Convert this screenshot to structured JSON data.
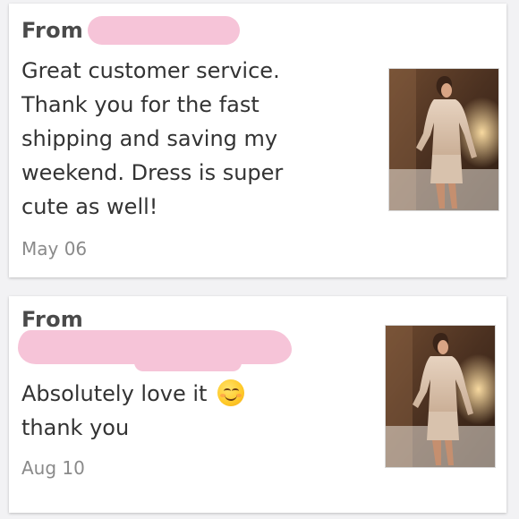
{
  "reviews": [
    {
      "from_label": "From",
      "text": "Great customer service.\nThank you for the fast\nshipping and saving my\nweekend. Dress is super\ncute as well!",
      "date": "May 06",
      "photo_icon": "product-photo"
    },
    {
      "from_label": "From",
      "text": "Absolutely love it",
      "text_line2": "thank you",
      "emoji": "smiling-face-emoji",
      "date": "Aug 10",
      "photo_icon": "product-photo"
    }
  ],
  "colors": {
    "background": "#f2f2f4",
    "card": "#ffffff",
    "redaction": "#f6c4d8",
    "text": "#333333",
    "date": "#8a8a8a"
  }
}
